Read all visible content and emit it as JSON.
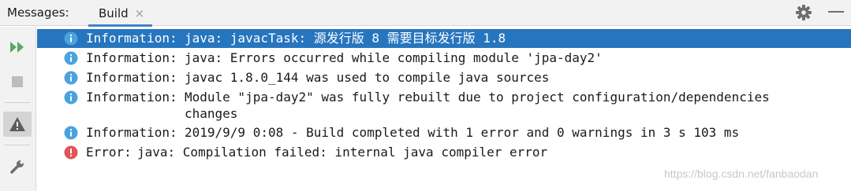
{
  "header": {
    "title": "Messages:",
    "tab_label": "Build",
    "tab_close": "×"
  },
  "toolbar": {
    "items": [
      "rerun-icon",
      "stop-icon",
      "warning-filter-icon",
      "settings-wrench-icon"
    ]
  },
  "messages": [
    {
      "kind": "Information:",
      "text": "java: javacTask: 源发行版 8 需要目标发行版 1.8",
      "level": "info",
      "selected": true
    },
    {
      "kind": "Information:",
      "text": "java: Errors occurred while compiling module 'jpa-day2'",
      "level": "info"
    },
    {
      "kind": "Information:",
      "text": "javac 1.8.0_144 was used to compile java sources",
      "level": "info"
    },
    {
      "kind": "Information:",
      "text": "Module \"jpa-day2\" was fully rebuilt due to project configuration/dependencies",
      "text2": "changes",
      "level": "info"
    },
    {
      "kind": "Information:",
      "text": "2019/9/9 0:08 - Build completed with 1 error and 0 warnings in 3 s 103 ms",
      "level": "info"
    },
    {
      "kind": "Error:",
      "text": "java: Compilation failed: internal java compiler error",
      "level": "error"
    }
  ],
  "colors": {
    "accent": "#2675bf",
    "info": "#4aa3df",
    "error": "#e05555",
    "run": "#59a869"
  },
  "watermark": "https://blog.csdn.net/fanbaodan"
}
